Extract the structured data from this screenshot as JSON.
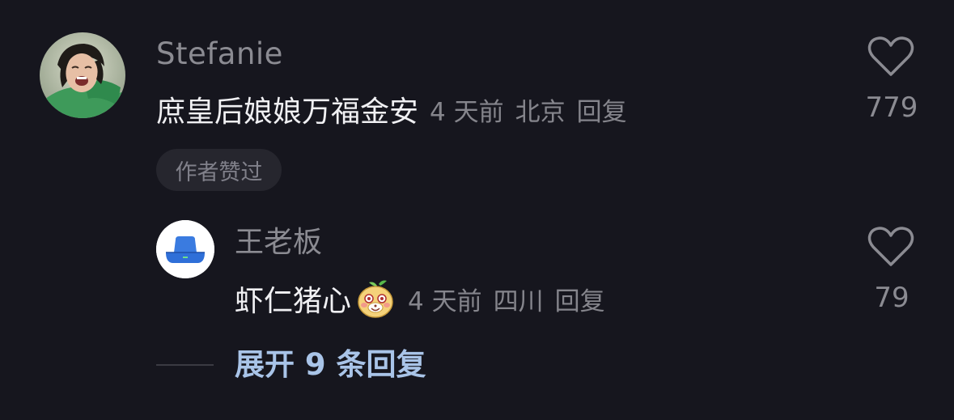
{
  "comment": {
    "username": "Stefanie",
    "text": "庶皇后娘娘万福金安",
    "time": "4 天前",
    "location": "北京",
    "reply_label": "回复",
    "like_count": "779",
    "author_badge": "作者赞过",
    "avatar_icon": "user-photo-avatar",
    "like_icon": "heart-outline-icon"
  },
  "reply": {
    "username": "王老板",
    "text": "虾仁猪心",
    "emoji_icon": "cute-pig-emoji",
    "time": "4 天前",
    "location": "四川",
    "reply_label": "回复",
    "like_count": "79",
    "avatar_icon": "blue-bucket-hat-avatar",
    "like_icon": "heart-outline-icon"
  },
  "expand": {
    "label": "展开 9 条回复"
  },
  "colors": {
    "background": "#16161e",
    "username": "#8b8b92",
    "comment_text": "#f0f0f3",
    "meta": "#85858c",
    "link": "#a9c4e8",
    "badge_bg": "#26262e"
  }
}
